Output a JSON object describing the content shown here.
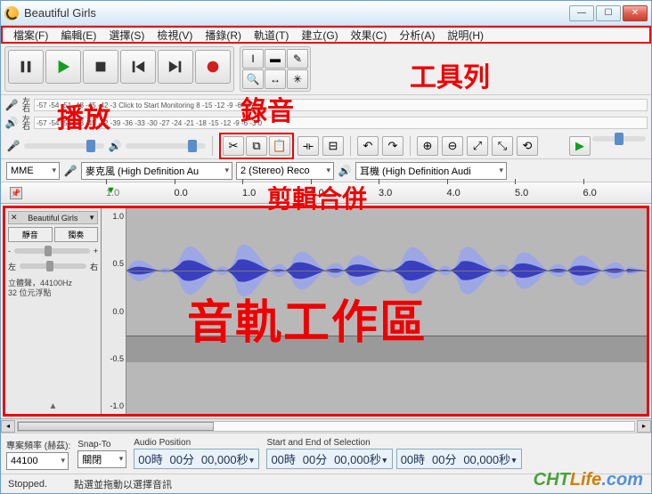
{
  "titlebar": {
    "title": "Beautiful Girls"
  },
  "menubar": {
    "items": [
      "檔案(F)",
      "編輯(E)",
      "選擇(S)",
      "檢視(V)",
      "播錄(R)",
      "軌道(T)",
      "建立(G)",
      "效果(C)",
      "分析(A)",
      "說明(H)"
    ]
  },
  "meters": {
    "rec_text": "-57  -54  -51  -48  -45  -42  -3 Click to Start Monitoring  8  -15  -12  -9  -6  -3  0",
    "play_text": "-57  -54  -51  -48  -45  -42  -39  -36  -33  -30  -27  -24  -21  -18  -15  -12  -9  -6  -3  0",
    "lr": "左\n右"
  },
  "devices": {
    "host": "MME",
    "input": "麥克風 (High Definition Au",
    "channels": "2 (Stereo) Reco",
    "output": "耳機 (High Definition Audi"
  },
  "ruler": {
    "marker": "▼",
    "ticks": [
      "1.0",
      "0.0",
      "1.0",
      "2.0",
      "3.0",
      "4.0",
      "5.0",
      "6.0"
    ]
  },
  "track": {
    "name": "Beautiful Girls",
    "mute": "靜音",
    "solo": "獨奏",
    "gain_l": "-",
    "gain_r": "+",
    "pan_l": "左",
    "pan_r": "右",
    "info1": "立體聲，44100Hz",
    "info2": "32 位元浮點",
    "yaxis": [
      "1.0",
      "0.5",
      "0.0",
      "-0.5",
      "-1.0"
    ]
  },
  "bottom": {
    "rate_label": "專案頻率 (赫茲):",
    "rate_value": "44100",
    "snap_label": "Snap-To",
    "snap_value": "關閉",
    "pos_label": "Audio Position",
    "pos_value_h": "00",
    "pos_value_m": "00",
    "pos_value_s": "00,000",
    "sel_label": "Start and End of Selection",
    "sel_s_h": "00",
    "sel_s_m": "00",
    "sel_s_s": "00,000",
    "sel_e_h": "00",
    "sel_e_m": "00",
    "sel_e_s": "00,000",
    "unit_h": "時",
    "unit_m": "分",
    "unit_s": "秒"
  },
  "status": {
    "state": "Stopped.",
    "hint": "點選並拖動以選擇音訊"
  },
  "annotations": {
    "toolbar": "工具列",
    "playback": "播放",
    "record": "錄音",
    "edit": "剪輯合併",
    "track": "音軌工作區"
  },
  "watermark": {
    "a": "CHT",
    "b": "Life",
    "c": ".com"
  }
}
